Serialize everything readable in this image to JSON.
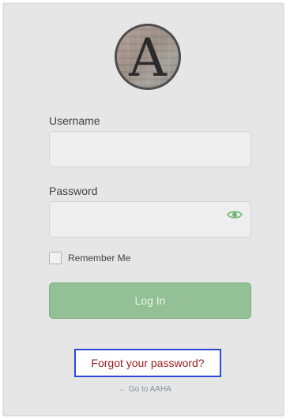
{
  "logo": {
    "letter": "A"
  },
  "form": {
    "username_label": "Username",
    "username_value": "",
    "password_label": "Password",
    "password_value": "",
    "show_password_icon": "eye-icon",
    "remember_label": "Remember Me",
    "remember_checked": false,
    "login_label": "Log In"
  },
  "links": {
    "forgot_password": "Forgot your password?",
    "go_to_site": "← Go to AAHA"
  },
  "colors": {
    "card_bg": "#e6e6e6",
    "button_bg": "#93c095",
    "link_red": "#9a1b1b",
    "focus_outline": "#2c48d6",
    "eye_icon": "#6fb36f"
  }
}
